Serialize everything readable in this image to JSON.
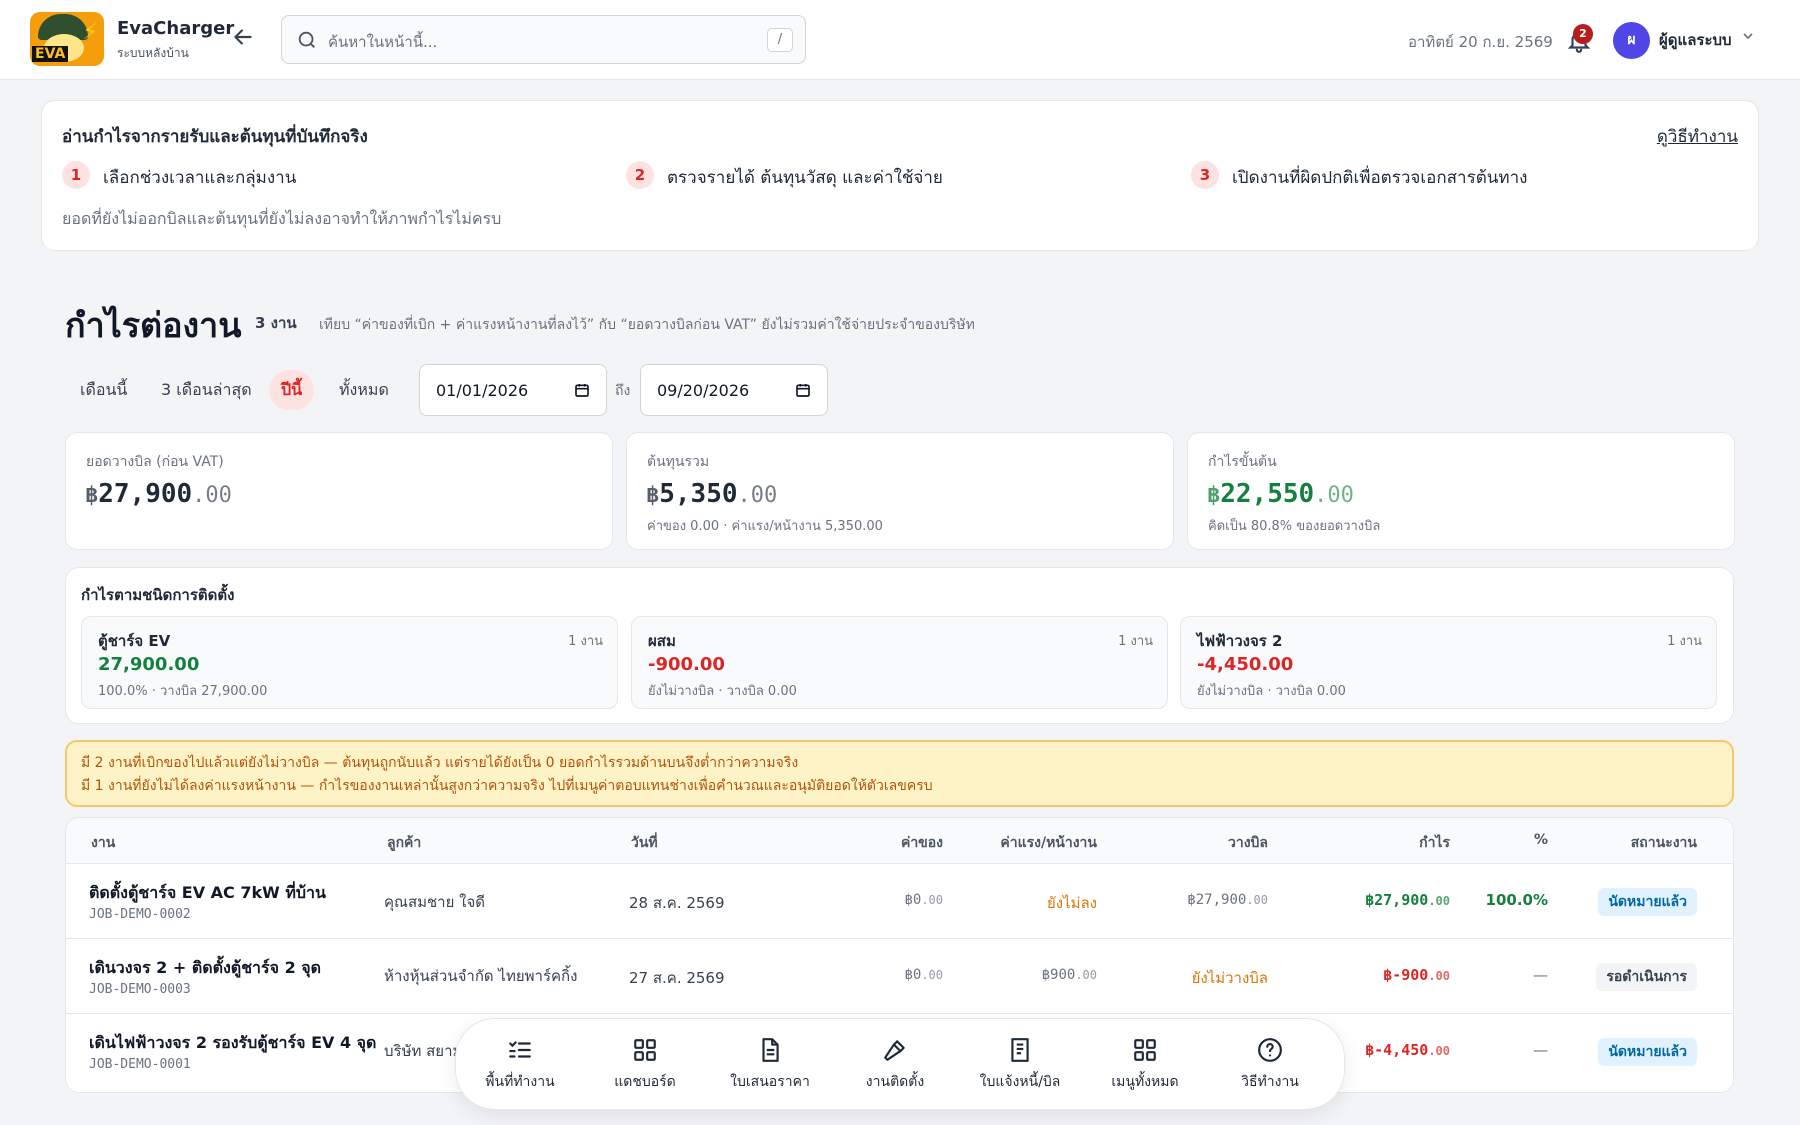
{
  "header": {
    "brand_name": "EvaCharger",
    "brand_sub": "ระบบหลังบ้าน",
    "logo_text": "EVA",
    "search_placeholder": "ค้นหาในหน้านี้...",
    "search_shortcut": "/",
    "date": "อาทิตย์ 20 ก.ย. 2569",
    "notification_count": "2",
    "avatar_initial": "ผ",
    "user_name": "ผู้ดูแลระบบ"
  },
  "guide": {
    "title": "อ่านกำไรจากรายรับและต้นทุนที่บันทึกจริง",
    "link": "ดูวิธีทำงาน",
    "steps": [
      {
        "num": "1",
        "text": "เลือกช่วงเวลาและกลุ่มงาน"
      },
      {
        "num": "2",
        "text": "ตรวจรายได้ ต้นทุนวัสดุ และค่าใช้จ่าย"
      },
      {
        "num": "3",
        "text": "เปิดงานที่ผิดปกติเพื่อตรวจเอกสารต้นทาง"
      }
    ],
    "note": "ยอดที่ยังไม่ออกบิลและต้นทุนที่ยังไม่ลงอาจทำให้ภาพกำไรไม่ครบ"
  },
  "page": {
    "title": "กำไรต่องาน",
    "count": "3 งาน",
    "description": "เทียบ “ค่าของที่เบิก + ค่าแรงหน้างานที่ลงไว้” กับ “ยอดวางบิลก่อน VAT” ยังไม่รวมค่าใช้จ่ายประจำของบริษัท"
  },
  "filters": {
    "ranges": [
      "เดือนนี้",
      "3 เดือนล่าสุด",
      "ปีนี้",
      "ทั้งหมด"
    ],
    "active": "ปีนี้",
    "from": "01/01/2026",
    "to_label": "ถึง",
    "to": "09/20/2026"
  },
  "summary": {
    "billed": {
      "label": "ยอดวางบิล (ก่อน VAT)",
      "currency": "฿",
      "int": "27,900",
      "dec": ".00"
    },
    "cost": {
      "label": "ต้นทุนรวม",
      "currency": "฿",
      "int": "5,350",
      "dec": ".00",
      "sub": "ค่าของ 0.00 · ค่าแรง/หน้างาน 5,350.00"
    },
    "profit": {
      "label": "กำไรขั้นต้น",
      "currency": "฿",
      "int": "22,550",
      "dec": ".00",
      "sub": "คิดเป็น 80.8% ของยอดวางบิล"
    }
  },
  "by_type": {
    "title": "กำไรตามชนิดการติดตั้ง",
    "items": [
      {
        "name": "ตู้ชาร์จ EV",
        "count": "1 งาน",
        "value": "27,900.00",
        "sub": "100.0% · วางบิล 27,900.00",
        "tone": "green"
      },
      {
        "name": "ผสม",
        "count": "1 งาน",
        "value": "-900.00",
        "sub": "ยังไม่วางบิล · วางบิล 0.00",
        "tone": "red"
      },
      {
        "name": "ไฟฟ้าวงจร 2",
        "count": "1 งาน",
        "value": "-4,450.00",
        "sub": "ยังไม่วางบิล · วางบิล 0.00",
        "tone": "red"
      }
    ]
  },
  "warning": {
    "line1": "มี 2 งานที่เบิกของไปแล้วแต่ยังไม่วางบิล — ต้นทุนถูกนับแล้ว แต่รายได้ยังเป็น 0 ยอดกำไรรวมด้านบนจึงต่ำกว่าความจริง",
    "line2": "มี 1 งานที่ยังไม่ได้ลงค่าแรงหน้างาน — กำไรของงานเหล่านั้นสูงกว่าความจริง ไปที่เมนูค่าตอบแทนช่างเพื่อคำนวณและอนุมัติยอดให้ตัวเลขครบ"
  },
  "table": {
    "headers": {
      "job": "งาน",
      "customer": "ลูกค้า",
      "date": "วันที่",
      "material": "ค่าของ",
      "labor": "ค่าแรง/หน้างาน",
      "billed": "วางบิล",
      "profit": "กำไร",
      "pct": "%",
      "status": "สถานะงาน"
    },
    "rows": [
      {
        "title": "ติดตั้งตู้ชาร์จ EV AC 7kW ที่บ้าน",
        "code": "JOB-DEMO-0002",
        "customer": "คุณสมชาย ใจดี",
        "date": "28 ส.ค. 2569",
        "material_int": "0",
        "material_dec": ".00",
        "labor": "ยังไม่ลง",
        "billed_int": "27,900",
        "billed_dec": ".00",
        "profit_int": "27,900",
        "profit_dec": ".00",
        "pct": "100.0%",
        "status": "นัดหมายแล้ว"
      },
      {
        "title": "เดินวงจร 2 + ติดตั้งตู้ชาร์จ 2 จุด",
        "code": "JOB-DEMO-0003",
        "customer": "ห้างหุ้นส่วนจำกัด ไทยพาร์คกิ้ง",
        "date": "27 ส.ค. 2569",
        "material_int": "0",
        "material_dec": ".00",
        "labor_int": "900",
        "labor_dec": ".00",
        "billed": "ยังไม่วางบิล",
        "profit_int": "-900",
        "profit_dec": ".00",
        "pct": "—",
        "status": "รอดำเนินการ"
      },
      {
        "title": "เดินไฟฟ้าวงจร 2 รองรับตู้ชาร์จ EV 4 จุด",
        "code": "JOB-DEMO-0001",
        "customer": "บริษัท สยาม",
        "profit_int": "-4,450",
        "profit_dec": ".00",
        "pct": "—",
        "status": "นัดหมายแล้ว"
      }
    ],
    "currency": "฿"
  },
  "bottom_nav": [
    {
      "label": "พื้นที่ทำงาน",
      "icon": "checklist-icon"
    },
    {
      "label": "แดชบอร์ด",
      "icon": "dashboard-icon"
    },
    {
      "label": "ใบเสนอราคา",
      "icon": "document-icon"
    },
    {
      "label": "งานติดตั้ง",
      "icon": "hammer-icon"
    },
    {
      "label": "ใบแจ้งหนี้/บิล",
      "icon": "receipt-icon"
    },
    {
      "label": "เมนูทั้งหมด",
      "icon": "grid-icon"
    },
    {
      "label": "วิธีทำงาน",
      "icon": "help-icon"
    }
  ],
  "colors": {
    "accent_red": "#dc2626",
    "profit_green": "#15803d",
    "warning_bg": "#fef3c7",
    "avatar": "#4f46e5"
  }
}
